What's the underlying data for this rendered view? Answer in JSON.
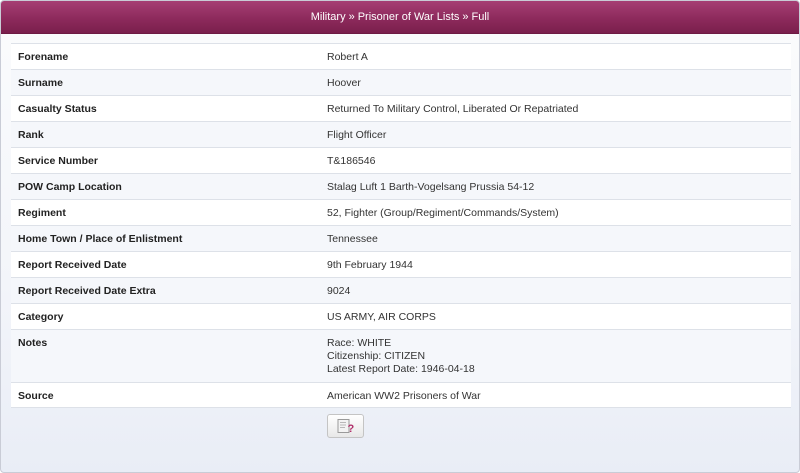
{
  "header": {
    "breadcrumb": [
      {
        "label": "Military"
      },
      {
        "label": "Prisoner of War Lists"
      },
      {
        "label": "Full"
      }
    ],
    "separator": "»"
  },
  "record": {
    "rows": [
      {
        "label": "Forename",
        "value": "Robert A"
      },
      {
        "label": "Surname",
        "value": "Hoover"
      },
      {
        "label": "Casualty Status",
        "value": "Returned To Military Control, Liberated Or Repatriated"
      },
      {
        "label": "Rank",
        "value": "Flight Officer"
      },
      {
        "label": "Service Number",
        "value": "T&186546"
      },
      {
        "label": "POW Camp Location",
        "value": "Stalag Luft 1 Barth-Vogelsang Prussia 54-12"
      },
      {
        "label": "Regiment",
        "value": "52, Fighter (Group/Regiment/Commands/System)"
      },
      {
        "label": "Home Town / Place of Enlistment",
        "value": "Tennessee"
      },
      {
        "label": "Report Received Date",
        "value": "9th February 1944"
      },
      {
        "label": "Report Received Date Extra",
        "value": "9024"
      },
      {
        "label": "Category",
        "value": "US ARMY, AIR CORPS"
      }
    ],
    "notes": {
      "label": "Notes",
      "lines": [
        "Race: WHITE",
        "Citizenship: CITIZEN",
        "Latest Report Date: 1946-04-18"
      ]
    },
    "source": {
      "label": "Source",
      "value": "American WW2 Prisoners of War"
    }
  },
  "help_button": {
    "icon": "help-document-icon",
    "glyph": "?"
  },
  "colors": {
    "header_bg": "#8d2a5c",
    "help_icon": "#b0306a"
  }
}
